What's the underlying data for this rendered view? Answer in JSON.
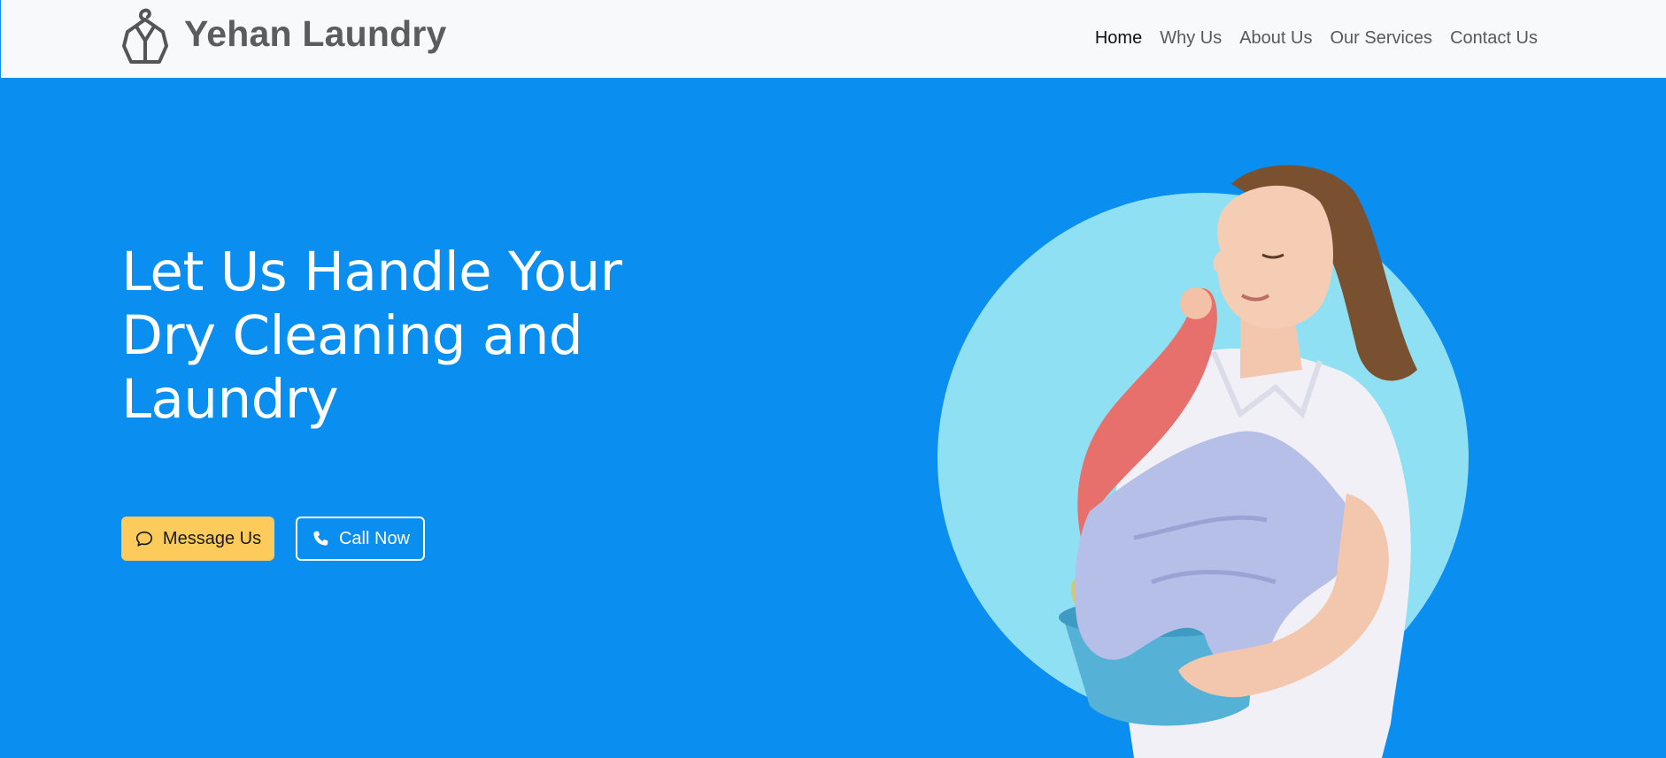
{
  "brand": {
    "name": "Yehan Laundry",
    "logo_icon": "hanger-shirt-icon"
  },
  "nav": {
    "items": [
      {
        "label": "Home",
        "active": true
      },
      {
        "label": "Why Us",
        "active": false
      },
      {
        "label": "About Us",
        "active": false
      },
      {
        "label": "Our Services",
        "active": false
      },
      {
        "label": "Contact Us",
        "active": false
      }
    ]
  },
  "hero": {
    "title": "Let Us Handle Your Dry Cleaning and Laundry",
    "buttons": {
      "message": {
        "label": "Message Us",
        "icon": "chat-bubble-icon"
      },
      "call": {
        "label": "Call Now",
        "icon": "phone-icon"
      }
    }
  },
  "colors": {
    "hero_bg": "#0a8ef0",
    "circle": "#8fe0f2",
    "accent": "#fdcb5b",
    "navbar_bg": "#f8f9fa"
  }
}
